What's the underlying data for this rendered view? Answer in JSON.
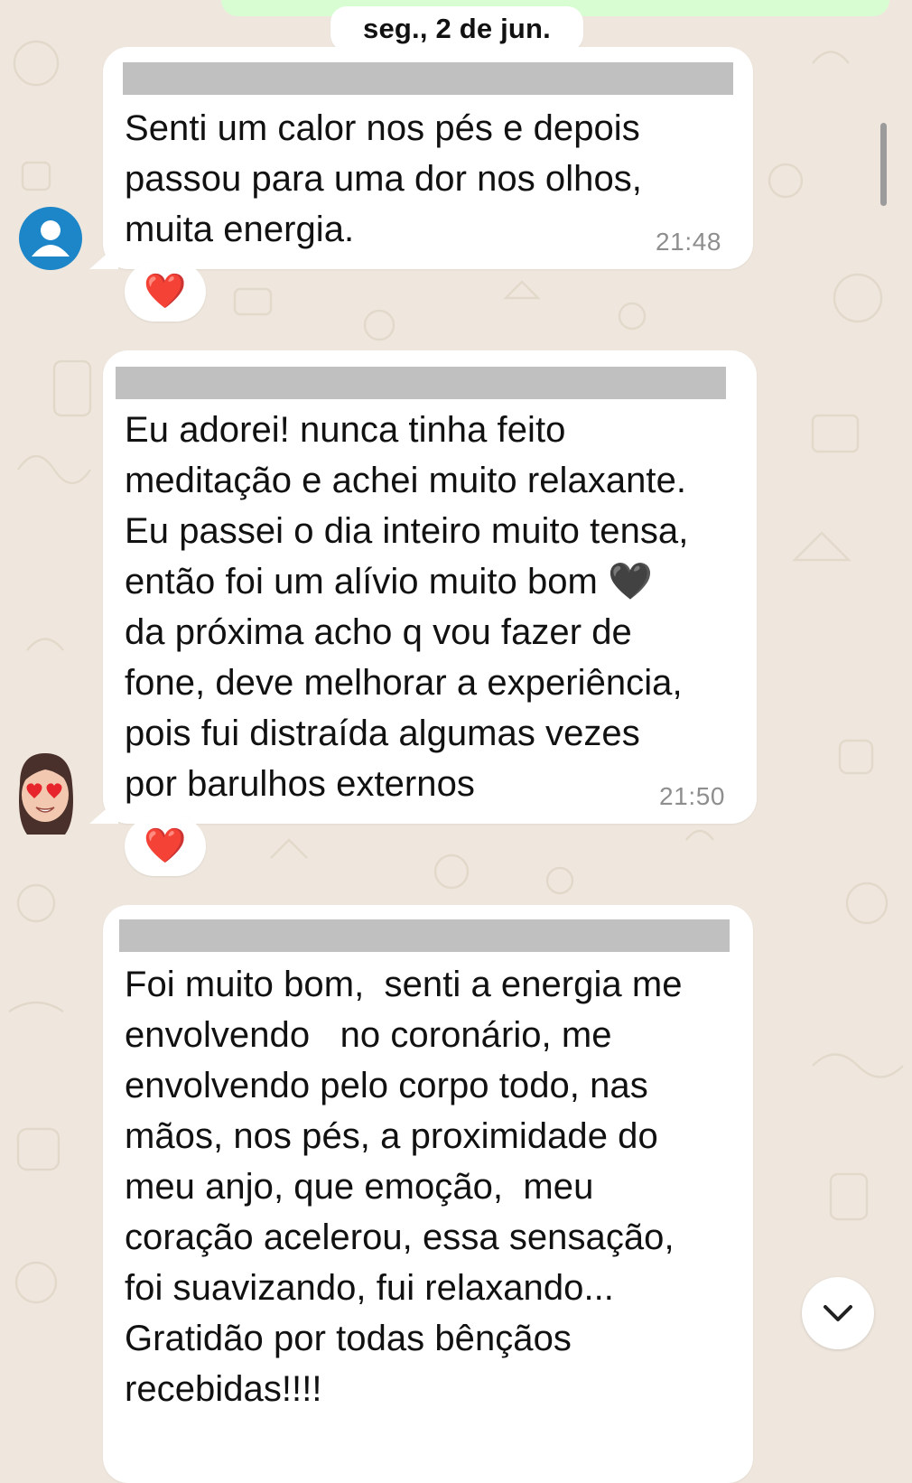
{
  "chat": {
    "date_separator": "seg., 2 de jun.",
    "messages": [
      {
        "text": "Senti um calor nos pés e depois\npassou para uma dor nos olhos,\nmuita energia.",
        "time": "21:48",
        "reaction": "❤️"
      },
      {
        "text": "Eu adorei! nunca tinha feito\nmeditação e achei muito relaxante.\nEu passei o dia inteiro muito tensa,\nentão foi um alívio muito bom 🖤\nda próxima acho q vou fazer de\nfone, deve melhorar a experiência,\npois fui distraída algumas vezes\npor barulhos externos",
        "time": "21:50",
        "reaction": "❤️"
      },
      {
        "text": "Foi muito bom,  senti a energia me\nenvolvendo   no coronário, me\nenvolvendo pelo corpo todo, nas\nmãos, nos pés, a proximidade do\nmeu anjo, que emoção,  meu\ncoração acelerou, essa sensação,\nfoi suavizando, fui relaxando...\nGratidão por todas bênçãos\nrecebidas!!!!"
      }
    ]
  },
  "icons": {
    "default_avatar": "person-avatar-icon",
    "memoji_avatar": "memoji-heart-eyes-avatar",
    "scroll_down": "chevron-down-icon",
    "wallpaper": "doodle-pattern"
  },
  "colors": {
    "wallpaper": "#efe7dd",
    "bubble": "#ffffff",
    "outgoing_bubble": "#d9fdd3",
    "redaction_bar": "#c0c0c0",
    "avatar_blue": "#1d86c8",
    "heart_red": "#e0141c",
    "timestamp": "#8e8e8e"
  }
}
